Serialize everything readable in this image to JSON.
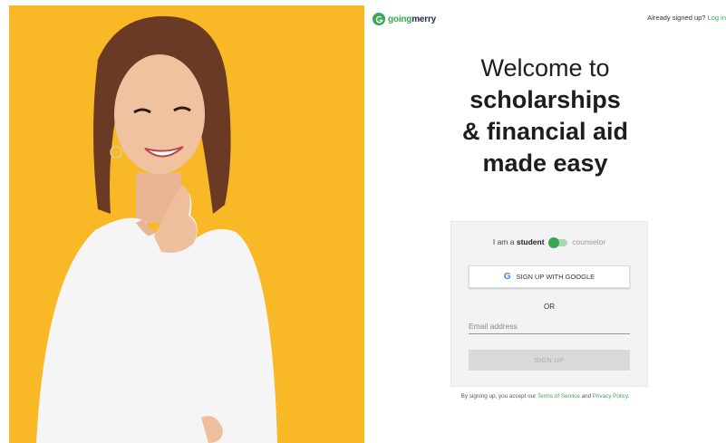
{
  "header": {
    "logo_prefix": "going",
    "logo_suffix": "merry",
    "signed_in_text": "Already signed up?",
    "login_link": "Log in"
  },
  "headline": {
    "line1": "Welcome to",
    "line2": "scholarships",
    "line3": "& financial aid",
    "line4": "made easy"
  },
  "form": {
    "role_prefix": "I am a",
    "role_student": "student",
    "role_counselor": "counselor",
    "role_selected": "student",
    "google_icon": "G",
    "google_button": "SIGN UP WITH GOOGLE",
    "or_text": "OR",
    "email_placeholder": "Email address",
    "email_value": "",
    "signup_button": "SIGN UP"
  },
  "legal": {
    "prefix": "By signing up, you accept our",
    "terms": "Terms of Service",
    "and": "and",
    "privacy": "Privacy Policy",
    "suffix": "."
  },
  "colors": {
    "brand_green": "#3aa655",
    "hero_yellow": "#f9b826"
  }
}
